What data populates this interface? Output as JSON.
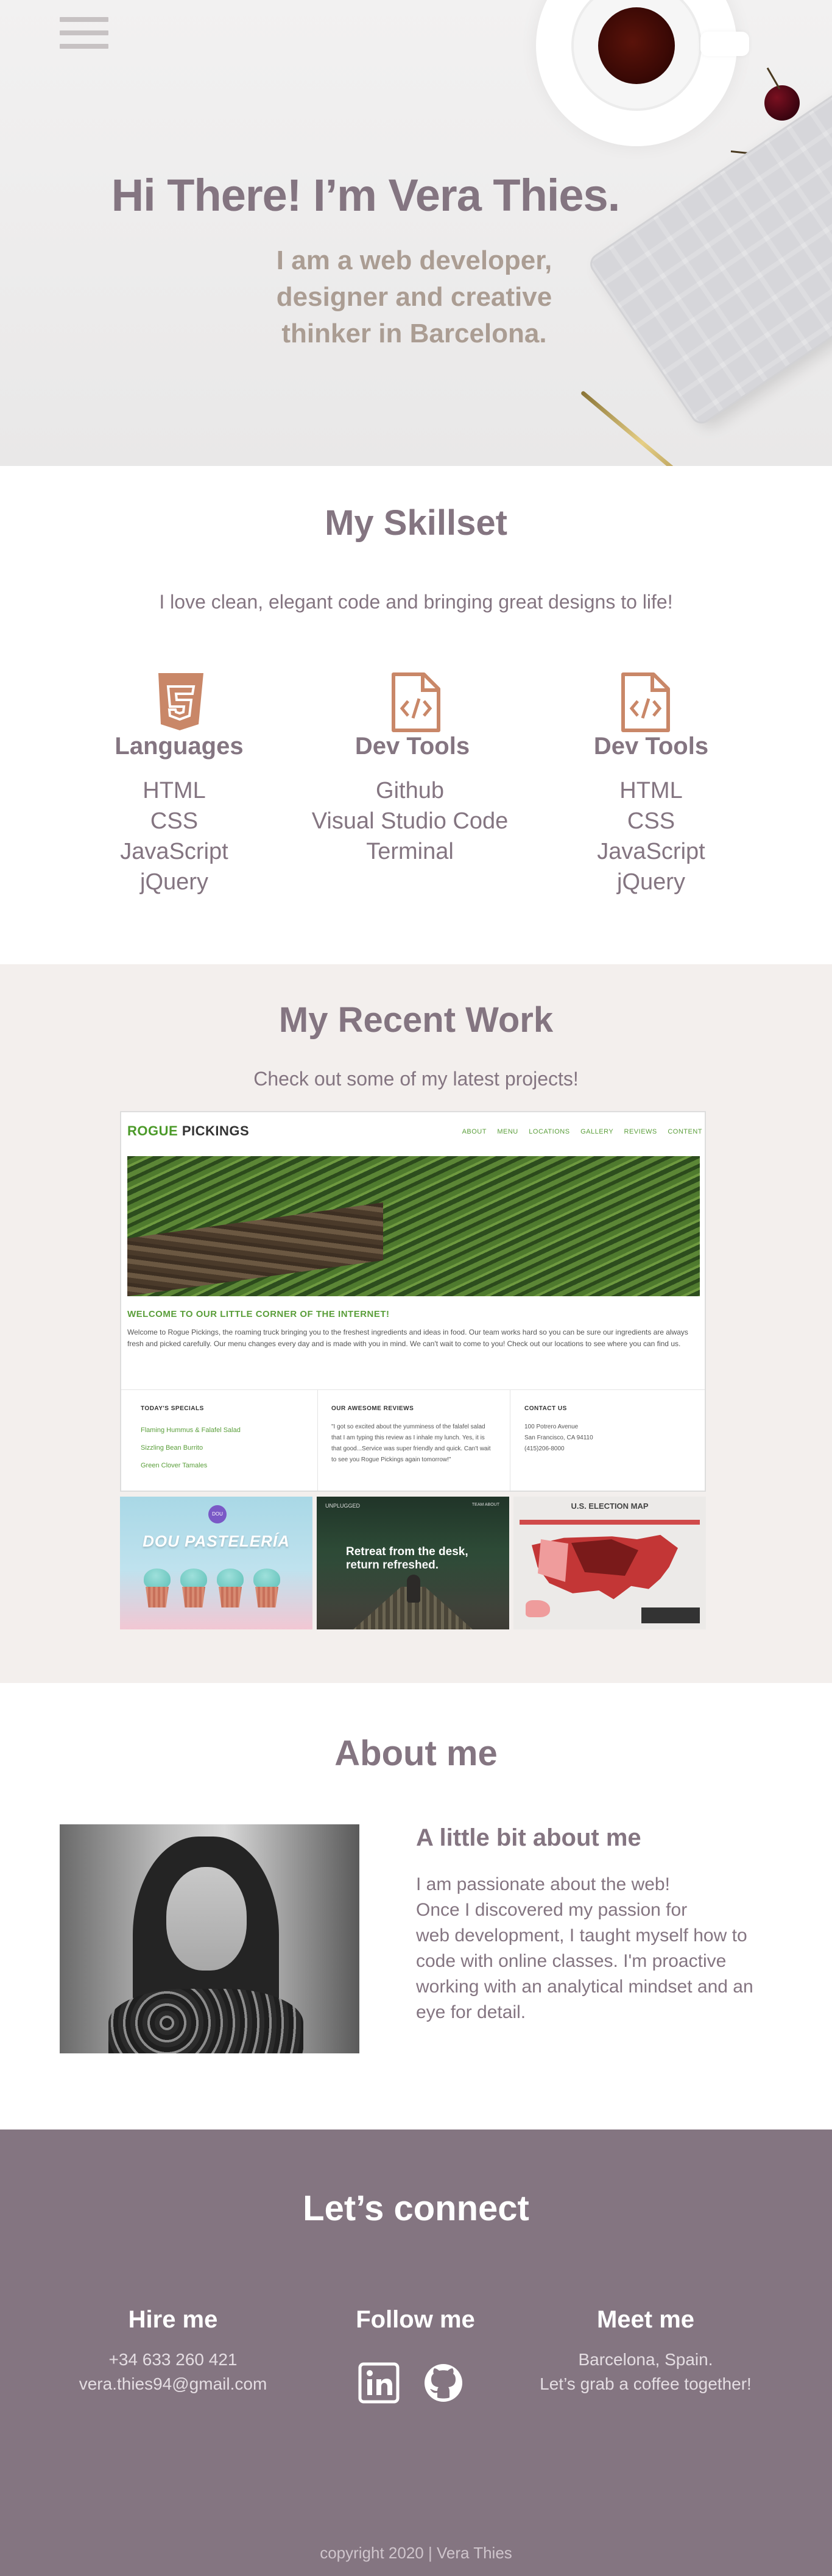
{
  "hero": {
    "title": "Hi There! I’m Vera Thies.",
    "subtitle": "I am a web developer, designer and creative thinker in Barcelona.",
    "menu_icon": "hamburger-icon"
  },
  "skills": {
    "title": "My Skillset",
    "subtitle": "I love clean, elegant code and bringing great designs to life!",
    "columns": [
      {
        "icon": "css3-icon",
        "heading": "Languages",
        "items": [
          "HTML",
          "CSS",
          "JavaScript",
          "jQuery"
        ]
      },
      {
        "icon": "code-file-icon",
        "heading": "Dev Tools",
        "items": [
          "Github",
          "Visual Studio Code",
          "Terminal"
        ]
      },
      {
        "icon": "code-file-icon",
        "heading": "Dev Tools",
        "items": [
          "HTML",
          "CSS",
          "JavaScript",
          "jQuery"
        ]
      }
    ],
    "accent_color": "#c98768"
  },
  "work": {
    "title": "My Recent Work",
    "subtitle": "Check out some of my latest projects!",
    "main_project": {
      "logo_green": "ROGUE",
      "logo_dark": "PICKINGS",
      "nav": [
        "ABOUT",
        "MENU",
        "LOCATIONS",
        "GALLERY",
        "REVIEWS",
        "CONTENT"
      ],
      "welcome": "WELCOME TO OUR LITTLE CORNER OF THE INTERNET!",
      "text": "Welcome to Rogue Pickings, the roaming truck bringing you to the freshest ingredients and ideas in food. Our team works hard so you can be sure our ingredients are always fresh and picked carefully. Our menu changes every day and is made with you in mind. We can't wait to come to you! Check out our locations to see where you can find us.",
      "col1_title": "TODAY'S SPECIALS",
      "col1_items": [
        "Flaming Hummus & Falafel Salad",
        "Sizzling Bean Burrito",
        "Green Clover Tamales"
      ],
      "col2_title": "OUR AWESOME REVIEWS",
      "col2_text": "\"I got so excited about the yumminess of the falafel salad that I am typing this review as I inhale my lunch. Yes, it is that good...Service was super friendly and quick. Can't wait to see you Rogue Pickings again tomorrow!\"",
      "col3_title": "CONTACT US",
      "col3_lines": [
        "100 Potrero Avenue",
        "San Francisco, CA 94110",
        "(415)206-8000"
      ]
    },
    "thumb1": {
      "badge": "DOU",
      "title": "DOU PASTELERÍA"
    },
    "thumb2": {
      "logo": "UNPLUGGED",
      "nav": "TEAM   ABOUT",
      "title_line1": "Retreat from the desk,",
      "title_line2": "return refreshed."
    },
    "thumb3": {
      "title": "U.S. ELECTION MAP"
    }
  },
  "about": {
    "title": "About me",
    "heading": "A little bit about me",
    "lines": [
      "I am passionate about the web!",
      "Once I discovered my passion for",
      "web development, I taught myself how to",
      "code with online classes. I'm proactive",
      "working with an analytical mindset and an",
      "eye for detail."
    ]
  },
  "footer": {
    "title": "Let’s connect",
    "hire": {
      "heading": "Hire me",
      "phone": "+34 633 260 421",
      "email": "vera.thies94@gmail.com"
    },
    "follow": {
      "heading": "Follow me",
      "icons": [
        "linkedin-icon",
        "github-icon"
      ]
    },
    "meet": {
      "heading": "Meet me",
      "line1": "Barcelona, Spain.",
      "line2": "Let’s grab a coffee together!"
    },
    "copyright": "copyright 2020 | Vera Thies",
    "background": "#847581"
  }
}
